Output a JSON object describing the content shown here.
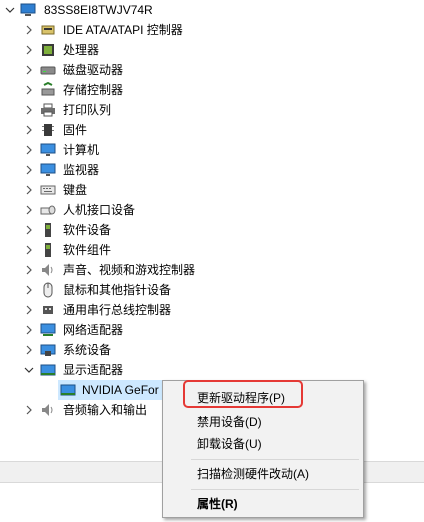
{
  "tree": {
    "root": "83SS8EI8TWJV74R",
    "items": [
      "IDE ATA/ATAPI 控制器",
      "处理器",
      "磁盘驱动器",
      "存储控制器",
      "打印队列",
      "固件",
      "计算机",
      "监视器",
      "键盘",
      "人机接口设备",
      "软件设备",
      "软件组件",
      "声音、视频和游戏控制器",
      "鼠标和其他指针设备",
      "通用串行总线控制器",
      "网络适配器",
      "系统设备",
      "显示适配器"
    ],
    "child": "NVIDIA GeFor",
    "after": "音频输入和输出"
  },
  "context_menu": {
    "update": "更新驱动程序(P)",
    "disable": "禁用设备(D)",
    "uninstall": "卸载设备(U)",
    "scan": "扫描检测硬件改动(A)",
    "properties": "属性(R)"
  },
  "colors": {
    "highlight_box": "#e53935",
    "selection": "#cde8ff",
    "menu_bg": "#f2f2f2"
  }
}
